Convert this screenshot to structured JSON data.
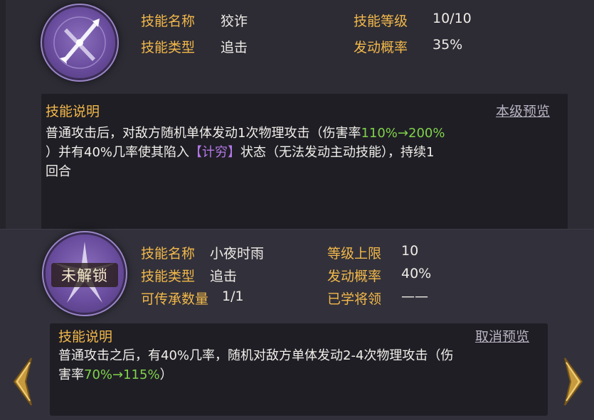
{
  "skill1": {
    "name_label": "技能名称",
    "name": "狡诈",
    "type_label": "技能类型",
    "type": "追击",
    "level_label": "技能等级",
    "level": "10/10",
    "chance_label": "发动概率",
    "chance": "35%",
    "desc_title": "技能说明",
    "preview_link": "本级预览",
    "desc": {
      "line1_a": "普通攻击后，对敌方随机单体发动1次物理攻击（伤害率",
      "line1_green": "110%→200%",
      "line2_a": "）并有40%几率使其陷入",
      "line2_status": "【计穷】",
      "line2_b": "状态（无法发动主动技能），持续1",
      "line3": "回合"
    }
  },
  "skill2": {
    "lock_label": "未解锁",
    "name_label": "技能名称",
    "name": "小夜时雨",
    "type_label": "技能类型",
    "type": "追击",
    "inherit_label": "可传承数量",
    "inherit": "1/1",
    "level_cap_label": "等级上限",
    "level_cap": "10",
    "chance_label": "发动概率",
    "chance": "40%",
    "learned_label": "已学将领",
    "learned": "——",
    "desc_title": "技能说明",
    "preview_link": "取消预览",
    "desc": {
      "line1": "普通攻击之后，有40%几率，随机对敌方单体发动2-4次物理攻击（伤",
      "line2_a": "害率",
      "line2_green": "70%→115%",
      "line2_b": "）"
    }
  },
  "nav": {
    "prev_icon": "chevron-left-icon",
    "next_icon": "chevron-right-icon"
  },
  "colors": {
    "label": "#f2b84a",
    "highlight_green": "#7fd34a",
    "status_purple": "#b278e6",
    "arrow": "#c79a3e"
  }
}
